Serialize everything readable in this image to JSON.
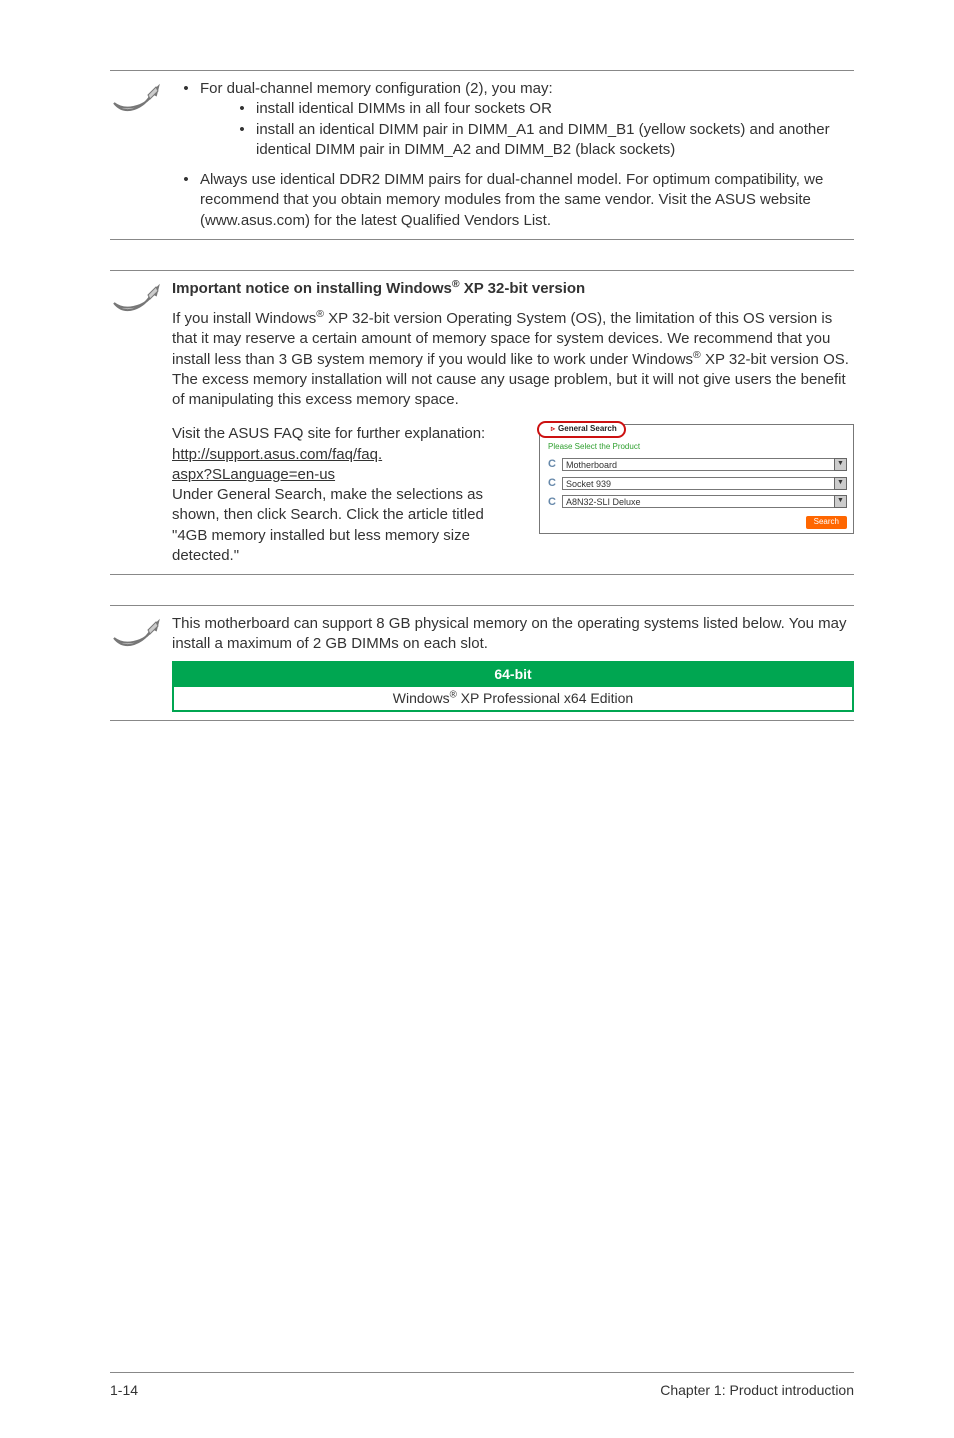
{
  "section1": {
    "b1": "For dual-channel memory configuration (2), you may:",
    "b1a": "install identical DIMMs in all four sockets OR",
    "b1b": "install an identical DIMM pair in DIMM_A1 and DIMM_B1 (yellow sockets) and another identical DIMM pair in DIMM_A2 and DIMM_B2 (black sockets)",
    "b2": "Always use identical DDR2 DIMM pairs for dual-channel model. For optimum compatibility, we recommend that you obtain memory modules from the same vendor. Visit the ASUS website (www.asus.com) for the latest Qualified Vendors List."
  },
  "section2": {
    "title_pre": "Important notice on installing Windows",
    "title_sup": "®",
    "title_post": " XP 32-bit version",
    "para_pre": "If you install Windows",
    "para_mid1": " XP 32-bit version Operating System (OS), the limitation of this OS version is that it may reserve a certain amount of memory space for system devices. We recommend that you install less than 3 GB system memory if you would like to work under Windows",
    "para_mid2": " XP 32-bit version OS. The excess memory installation will not cause any usage problem, but it will not give users the benefit of manipulating this excess memory space.",
    "left1": "Visit the ASUS FAQ site for further explanation:",
    "link1": "http://support.asus.com/faq/faq.",
    "link2": "aspx?SLanguage=en-us",
    "left2": "Under General Search, make the selections as shown, then click Search. Click the article titled \"4GB memory installed but less memory size detected.\"",
    "faq": {
      "tab": "General Search",
      "instr": "Please Select the Product",
      "f1": "Motherboard",
      "f2": "Socket 939",
      "f3": "A8N32-SLI Deluxe",
      "search": "Search"
    }
  },
  "section3": {
    "line": "This motherboard can support 8 GB physical memory on the operating systems listed below. You may install a maximum of 2 GB DIMMs on each slot.",
    "th": "64-bit",
    "td_pre": "Windows",
    "td_sup": "®",
    "td_post": " XP Professional x64 Edition"
  },
  "footer": {
    "left": "1-14",
    "right": "Chapter 1: Product introduction"
  },
  "bullet": "•",
  "c_mark": "C"
}
